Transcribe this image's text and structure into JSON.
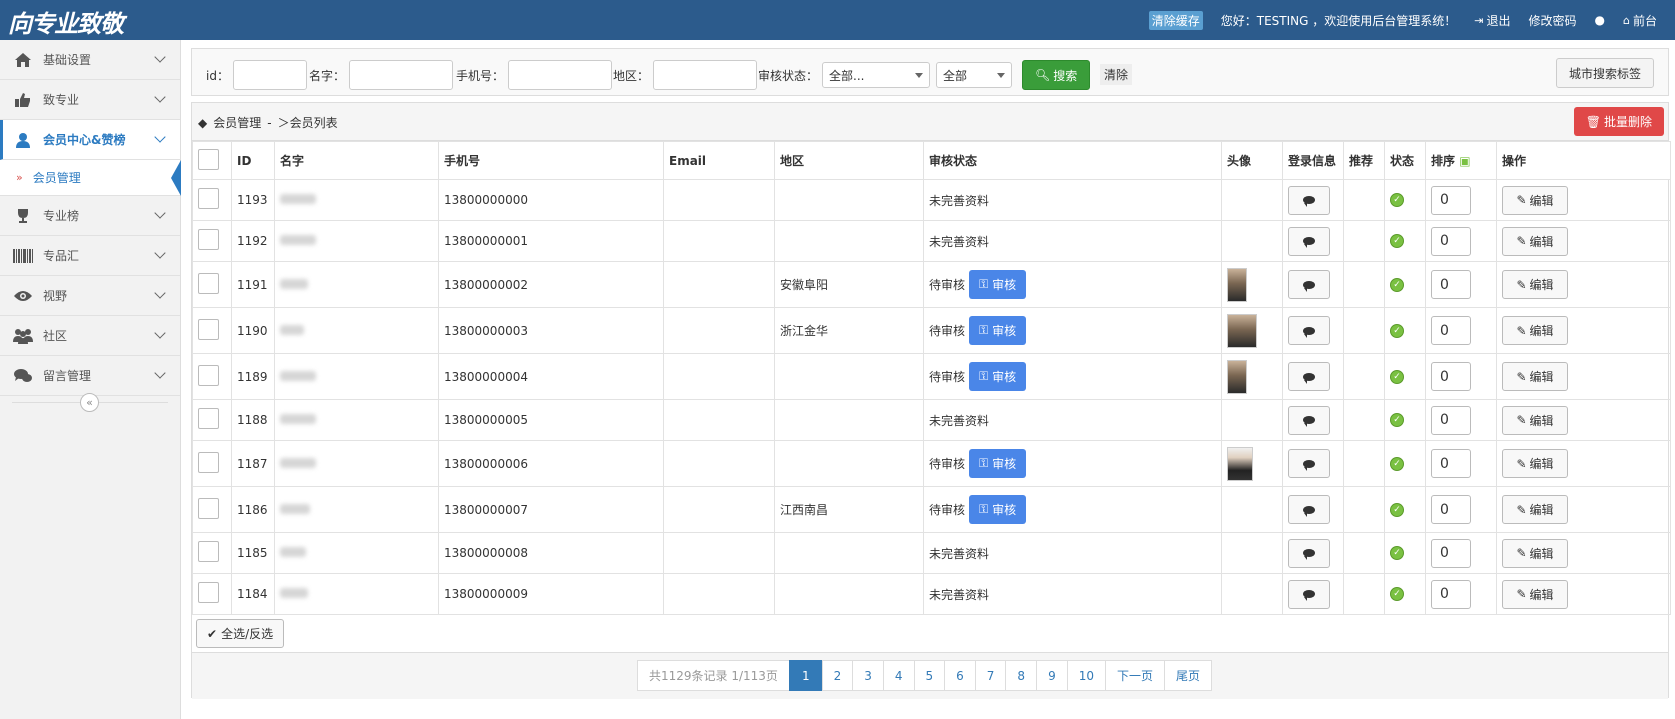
{
  "header": {
    "logo": "向专业致敬",
    "clear_cache": "清除缓存",
    "greeting": "您好：TESTING ，欢迎使用后台管理系统！",
    "logout": "退出",
    "change_password": "修改密码",
    "frontend": "前台"
  },
  "sidebar": {
    "items": [
      {
        "label": "基础设置",
        "icon": "home-icon"
      },
      {
        "label": "致专业",
        "icon": "thumbs-up-icon"
      },
      {
        "label": "会员中心&赞榜",
        "icon": "user-icon"
      },
      {
        "label": "专业榜",
        "icon": "trophy-icon"
      },
      {
        "label": "专品汇",
        "icon": "barcode-icon"
      },
      {
        "label": "视野",
        "icon": "eye-icon"
      },
      {
        "label": "社区",
        "icon": "users-icon"
      },
      {
        "label": "留言管理",
        "icon": "comments-icon"
      }
    ],
    "sub_item": "会员管理"
  },
  "search": {
    "id_label": "id：",
    "name_label": "名字：",
    "phone_label": "手机号：",
    "region_label": "地区：",
    "status_label": "审核状态：",
    "status_select": "全部...",
    "all_select": "全部",
    "search_button": "搜索",
    "clear_button": "清除",
    "city_tags_button": "城市搜索标签"
  },
  "breadcrumb": {
    "part1": "会员管理",
    "sep": "-",
    "part2": "＞会员列表"
  },
  "batch_delete": "批量删除",
  "columns": [
    "ID",
    "名字",
    "手机号",
    "Email",
    "地区",
    "审核状态",
    "头像",
    "登录信息",
    "推荐",
    "状态",
    "排序",
    "操作"
  ],
  "audit_button": "审核",
  "edit_button": "编辑",
  "rows": [
    {
      "id": "1193",
      "phone": "13800000000",
      "region": "",
      "status": "未完善资料",
      "audit": false,
      "avatar": false,
      "sort": "0"
    },
    {
      "id": "1192",
      "phone": "13800000001",
      "region": "",
      "status": "未完善资料",
      "audit": false,
      "avatar": false,
      "sort": "0"
    },
    {
      "id": "1191",
      "phone": "13800000002",
      "region": "安徽阜阳",
      "status": "待审核",
      "audit": true,
      "avatar": true,
      "sort": "0"
    },
    {
      "id": "1190",
      "phone": "13800000003",
      "region": "浙江金华",
      "status": "待审核",
      "audit": true,
      "avatar": true,
      "sort": "0"
    },
    {
      "id": "1189",
      "phone": "13800000004",
      "region": "",
      "status": "待审核",
      "audit": true,
      "avatar": true,
      "sort": "0"
    },
    {
      "id": "1188",
      "phone": "13800000005",
      "region": "",
      "status": "未完善资料",
      "audit": false,
      "avatar": false,
      "sort": "0"
    },
    {
      "id": "1187",
      "phone": "13800000006",
      "region": "",
      "status": "待审核",
      "audit": true,
      "avatar": true,
      "sort": "0"
    },
    {
      "id": "1186",
      "phone": "13800000007",
      "region": "江西南昌",
      "status": "待审核",
      "audit": true,
      "avatar": false,
      "sort": "0"
    },
    {
      "id": "1185",
      "phone": "13800000008",
      "region": "",
      "status": "未完善资料",
      "audit": false,
      "avatar": false,
      "sort": "0"
    },
    {
      "id": "1184",
      "phone": "13800000009",
      "region": "",
      "status": "未完善资料",
      "audit": false,
      "avatar": false,
      "sort": "0"
    }
  ],
  "select_all": "全选/反选",
  "pager": {
    "info": "共1129条记录 1/113页",
    "pages": [
      "1",
      "2",
      "3",
      "4",
      "5",
      "6",
      "7",
      "8",
      "9",
      "10"
    ],
    "current": "1",
    "next": "下一页",
    "last": "尾页"
  }
}
